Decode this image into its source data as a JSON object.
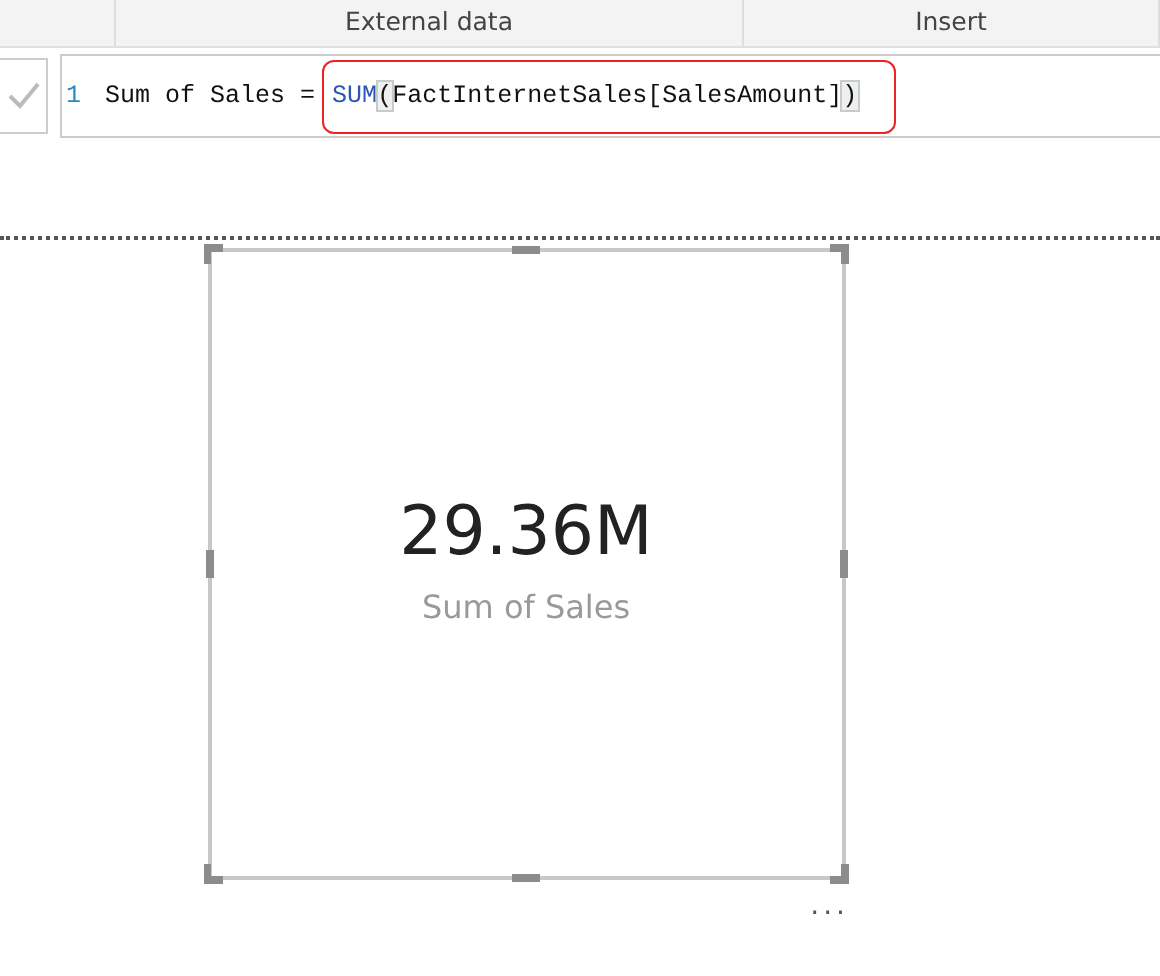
{
  "ribbon_groups": [
    {
      "label": "External data"
    },
    {
      "label": "Insert"
    }
  ],
  "formula_bar": {
    "line_number": "1",
    "plain": "Sum of Sales = ",
    "highlighted": [
      {
        "kind": "function",
        "text": "SUM"
      },
      {
        "kind": "bracket",
        "text": "("
      },
      {
        "kind": "text",
        "text": "FactInternetSales[SalesAmount]"
      },
      {
        "kind": "bracket",
        "text": ")"
      }
    ]
  },
  "card": {
    "value": "29.36M",
    "label": "Sum of Sales",
    "selected": true,
    "more": "..."
  }
}
